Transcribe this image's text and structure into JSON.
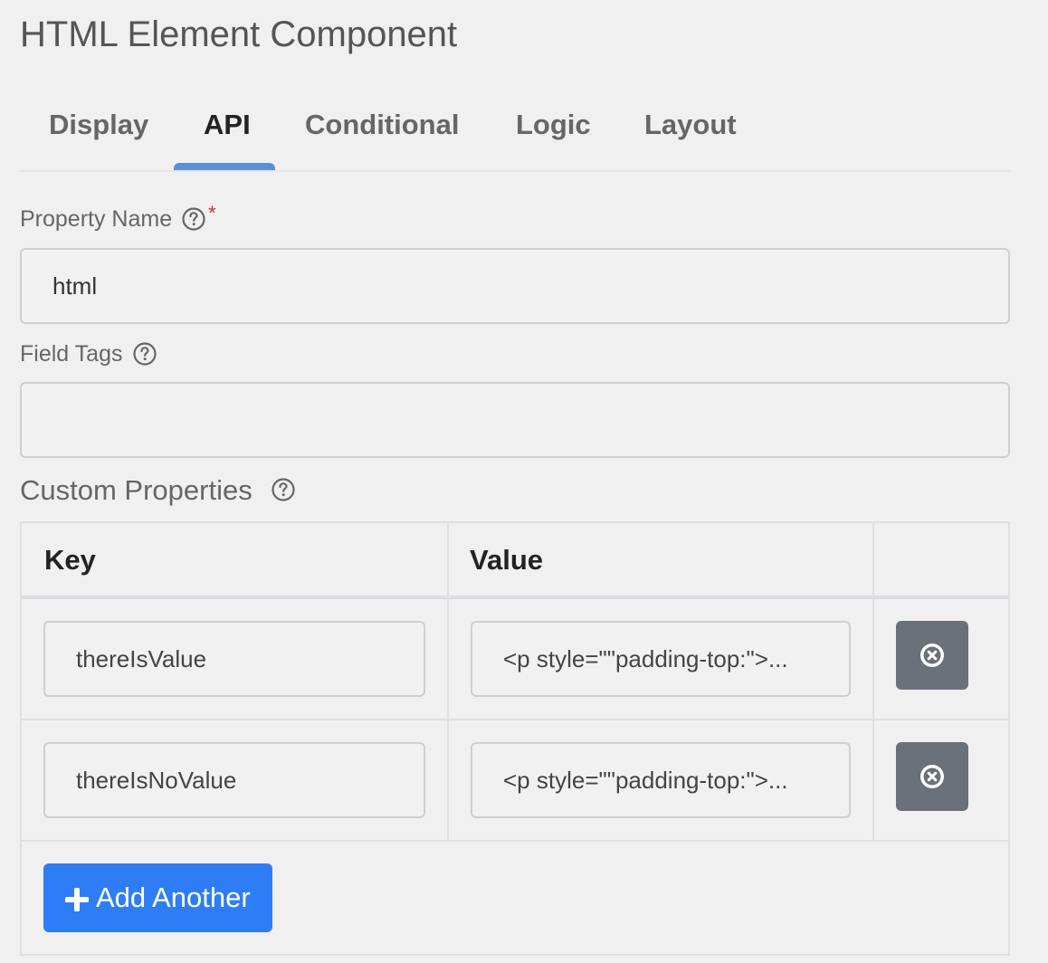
{
  "page": {
    "title": "HTML Element Component"
  },
  "tabs": [
    {
      "label": "Display"
    },
    {
      "label": "API"
    },
    {
      "label": "Conditional"
    },
    {
      "label": "Logic"
    },
    {
      "label": "Layout"
    }
  ],
  "active_tab": "API",
  "property_name": {
    "label": "Property Name",
    "required_mark": "*",
    "value": "html",
    "help_icon": "question-circle-icon"
  },
  "field_tags": {
    "label": "Field Tags",
    "value": "",
    "help_icon": "question-circle-icon"
  },
  "custom_properties": {
    "label": "Custom Properties",
    "help_icon": "question-circle-icon",
    "columns": [
      "Key",
      "Value"
    ],
    "rows": [
      {
        "key": "thereIsValue",
        "value": "<p style=\"\"padding-top:\">..."
      },
      {
        "key": "thereIsNoValue",
        "value": "<p style=\"\"padding-top:\">..."
      }
    ],
    "remove_icon": "times-circle-icon",
    "add_button_label": "Add Another",
    "add_icon": "plus-icon"
  },
  "colors": {
    "accent": "#2f7df6",
    "tab_indicator": "#5b8fd8",
    "remove_button": "#6b717a",
    "required": "#c0392b"
  }
}
